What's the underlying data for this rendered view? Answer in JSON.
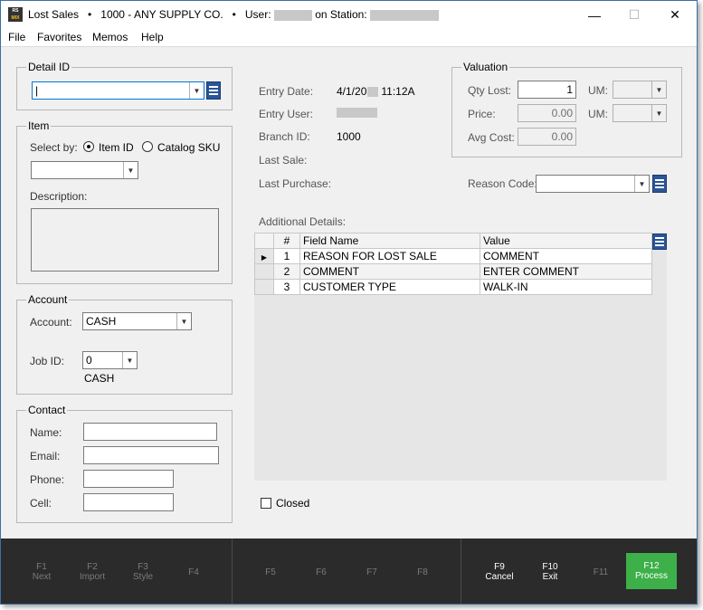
{
  "titlebar": {
    "title": "Lost Sales",
    "company": "1000 - ANY SUPPLY CO.",
    "user_label": "User:",
    "station_label": "on Station:",
    "logo_top": "RS",
    "logo_bottom": "MIX",
    "minimize": "—",
    "maximize": "☐",
    "close": "✕"
  },
  "menu": [
    "File",
    "Favorites",
    "Memos",
    "Help"
  ],
  "detail": {
    "legend": "Detail ID",
    "value": "|"
  },
  "item": {
    "legend": "Item",
    "select_by_label": "Select by:",
    "option_item_id": "Item ID",
    "option_catalog_sku": "Catalog SKU",
    "selected_option": "Item ID",
    "item_value": "",
    "description_label": "Description:"
  },
  "account": {
    "legend": "Account",
    "account_label": "Account:",
    "account_value": "CASH",
    "job_label": "Job ID:",
    "job_value": "0",
    "job_name": "CASH"
  },
  "contact": {
    "legend": "Contact",
    "name_label": "Name:",
    "email_label": "Email:",
    "phone_label": "Phone:",
    "cell_label": "Cell:"
  },
  "info": {
    "entry_date_label": "Entry Date:",
    "entry_date_value": "4/1/20",
    "entry_time_value": "11:12A",
    "entry_user_label": "Entry User:",
    "branch_label": "Branch ID:",
    "branch_value": "1000",
    "last_sale_label": "Last Sale:",
    "last_purchase_label": "Last Purchase:",
    "reason_label": "Reason Code:",
    "reason_value": ""
  },
  "valuation": {
    "legend": "Valuation",
    "qty_label": "Qty Lost:",
    "qty_value": "1",
    "um_label": "UM:",
    "price_label": "Price:",
    "price_value": "0.00",
    "avg_cost_label": "Avg Cost:",
    "avg_cost_value": "0.00"
  },
  "details": {
    "label": "Additional Details:",
    "columns": [
      "#",
      "Field Name",
      "Value"
    ],
    "rows": [
      {
        "num": "1",
        "field": "REASON FOR LOST SALE",
        "value": "COMMENT"
      },
      {
        "num": "2",
        "field": "COMMENT",
        "value": "ENTER COMMENT"
      },
      {
        "num": "3",
        "field": "CUSTOMER TYPE",
        "value": "WALK-IN"
      }
    ]
  },
  "closed_label": "Closed",
  "fkeys": [
    {
      "key": "F1",
      "label": "Next"
    },
    {
      "key": "F2",
      "label": "Import"
    },
    {
      "key": "F3",
      "label": "Style"
    },
    {
      "key": "F4",
      "label": ""
    },
    {
      "key": "F5",
      "label": ""
    },
    {
      "key": "F6",
      "label": ""
    },
    {
      "key": "F7",
      "label": ""
    },
    {
      "key": "F8",
      "label": ""
    },
    {
      "key": "F9",
      "label": "Cancel"
    },
    {
      "key": "F10",
      "label": "Exit"
    },
    {
      "key": "F11",
      "label": ""
    },
    {
      "key": "F12",
      "label": "Process"
    }
  ],
  "colors": {
    "process": "#3db049",
    "list_button": "#2a5599",
    "fbar": "#2b2b2b"
  }
}
